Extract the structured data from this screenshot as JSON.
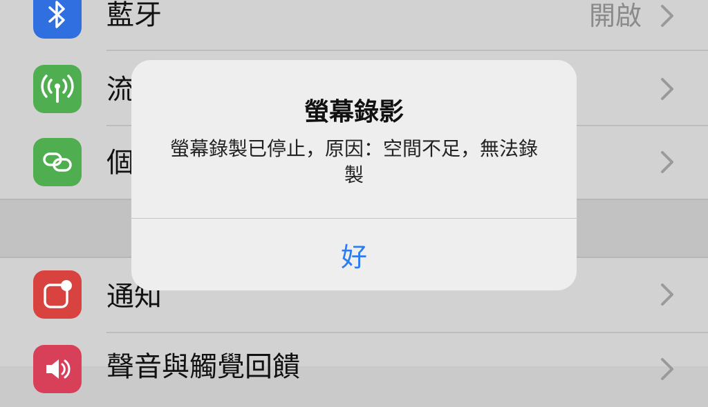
{
  "settings": {
    "rows": [
      {
        "label": "藍牙",
        "value": "開啟",
        "icon": "bluetooth-icon",
        "color": "#2f6fe0"
      },
      {
        "label": "流",
        "value": "",
        "icon": "antenna-icon",
        "color": "#4fae4f"
      },
      {
        "label": "個",
        "value": "",
        "icon": "chain-link-icon",
        "color": "#4fae4f"
      },
      {
        "label": "通知",
        "value": "",
        "icon": "notification-icon",
        "color": "#d8433f"
      },
      {
        "label": "聲音與觸覺回饋",
        "value": "",
        "icon": "speaker-icon",
        "color": "#d8405a"
      }
    ]
  },
  "alert": {
    "title": "螢幕錄影",
    "message": "螢幕錄製已停止，原因：空間不足，無法錄製",
    "button_label": "好",
    "accent": "#2b7cf0"
  }
}
